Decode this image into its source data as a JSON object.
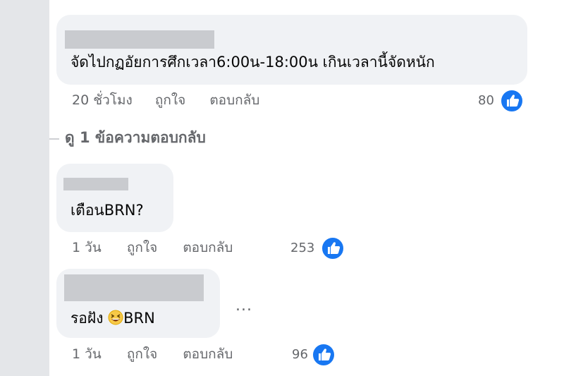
{
  "comments": [
    {
      "author": "",
      "text": "จัดไปกฏอัยการศึกเวลา6:00น-18:00น เกินเวลานี้จัดหนัก",
      "time": "20 ชั่วโมง",
      "like_label": "ถูกใจ",
      "reply_label": "ตอบกลับ",
      "reactions": "80",
      "reaction_icon": "like-icon"
    },
    {
      "author": "",
      "text": "เตือนBRN?",
      "time": "1 วัน",
      "like_label": "ถูกใจ",
      "reply_label": "ตอบกลับ",
      "reactions": "253",
      "reaction_icon": "like-icon"
    },
    {
      "author": "",
      "text_prefix": "รอฝัง",
      "emoji": "grinning-squinting-face",
      "text_suffix": "BRN",
      "time": "1 วัน",
      "like_label": "ถูกใจ",
      "reply_label": "ตอบกลับ",
      "reactions": "96",
      "reaction_icon": "like-icon",
      "more_label": "..."
    }
  ],
  "view_replies": "ดู 1 ข้อความตอบกลับ",
  "colors": {
    "bubble": "#f0f2f5",
    "meta_text": "#65676b",
    "like_blue": "#1877f2",
    "side_strip": "#e4e6e9"
  }
}
